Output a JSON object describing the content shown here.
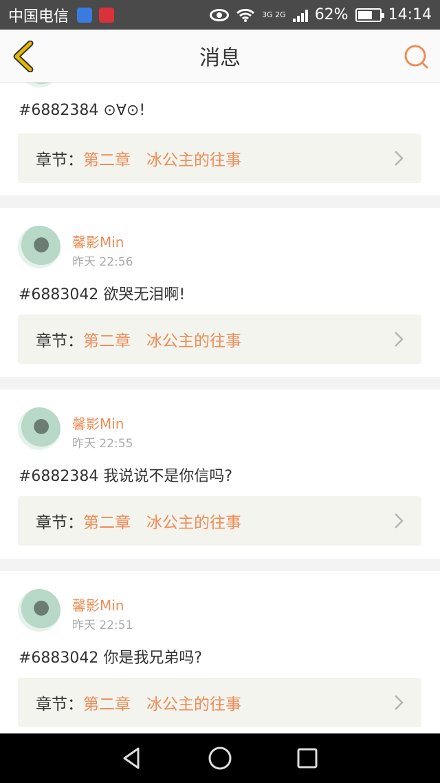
{
  "status_bar": {
    "carrier": "中国电信",
    "network": "3G 2G",
    "battery": "62%",
    "time": "14:14"
  },
  "header": {
    "title": "消息",
    "back_icon": "back-chevron-icon",
    "search_icon": "search-icon"
  },
  "colors": {
    "accent": "#ef8c56",
    "back_icon": "#d9a400",
    "card_bg": "#ffffff",
    "chapter_bg": "#f4f4ef"
  },
  "messages": [
    {
      "text": "#6882384 ⊙∀⊙!",
      "chapter_label": "章节：",
      "chapter_name": "第二章　冰公主的往事"
    },
    {
      "username": "馨影Min",
      "time": "昨天 22:56",
      "text": "#6883042 欲哭无泪啊!",
      "chapter_label": "章节：",
      "chapter_name": "第二章　冰公主的往事"
    },
    {
      "username": "馨影Min",
      "time": "昨天 22:55",
      "text": "#6882384 我说说不是你信吗?",
      "chapter_label": "章节：",
      "chapter_name": "第二章　冰公主的往事"
    },
    {
      "username": "馨影Min",
      "time": "昨天 22:51",
      "text": "#6883042 你是我兄弟吗?",
      "chapter_label": "章节：",
      "chapter_name": "第二章　冰公主的往事"
    }
  ]
}
